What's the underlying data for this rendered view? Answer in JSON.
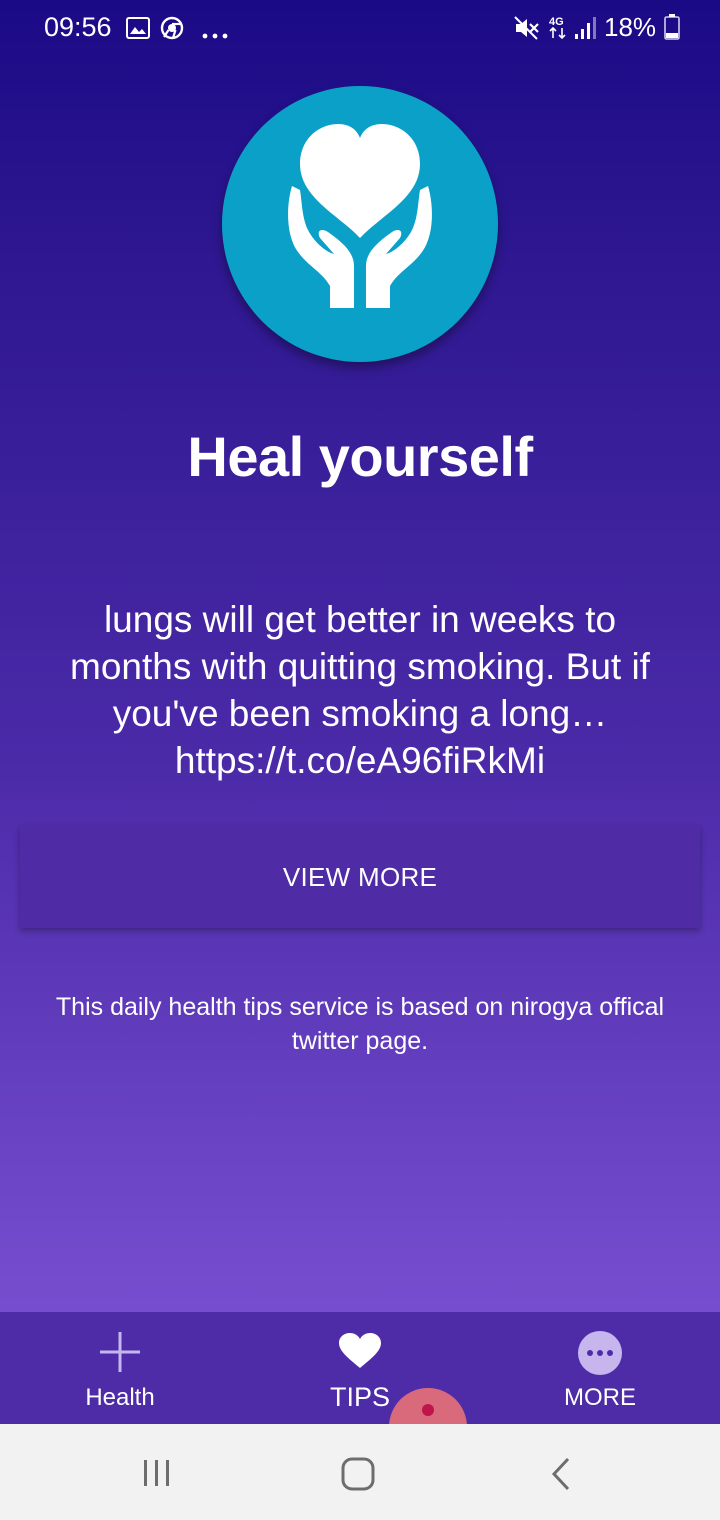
{
  "status_bar": {
    "time": "09:56",
    "network": "4G",
    "battery": "18%",
    "icons": [
      "image-icon",
      "chrome-icon",
      "more-dots-icon",
      "mute-icon",
      "network-4g-icon",
      "signal-icon",
      "battery-icon"
    ]
  },
  "logo": {
    "icon": "heart-hands-icon",
    "circle_color": "#0aa0c8"
  },
  "main": {
    "title": "Heal yourself",
    "tip": "lungs will get better in weeks to months with quitting smoking. But if you've been smoking a long… https://t.co/eA96fiRkMi",
    "view_more_label": "VIEW MORE",
    "footer_note": "This daily health tips service is based on nirogya offical twitter page."
  },
  "bottom_nav": {
    "items": [
      {
        "label": "Health",
        "icon": "plus-icon"
      },
      {
        "label": "TIPS",
        "icon": "heart-icon",
        "active": true
      },
      {
        "label": "MORE",
        "icon": "more-circle-icon"
      }
    ]
  },
  "system_nav": {
    "icons": [
      "recent-apps-icon",
      "home-icon",
      "back-icon"
    ]
  },
  "colors": {
    "background_top": "#1a0a86",
    "background_bottom": "#8559d8",
    "button_bg": "#4f2ba6",
    "nav_bg": "#4e2ca7"
  }
}
